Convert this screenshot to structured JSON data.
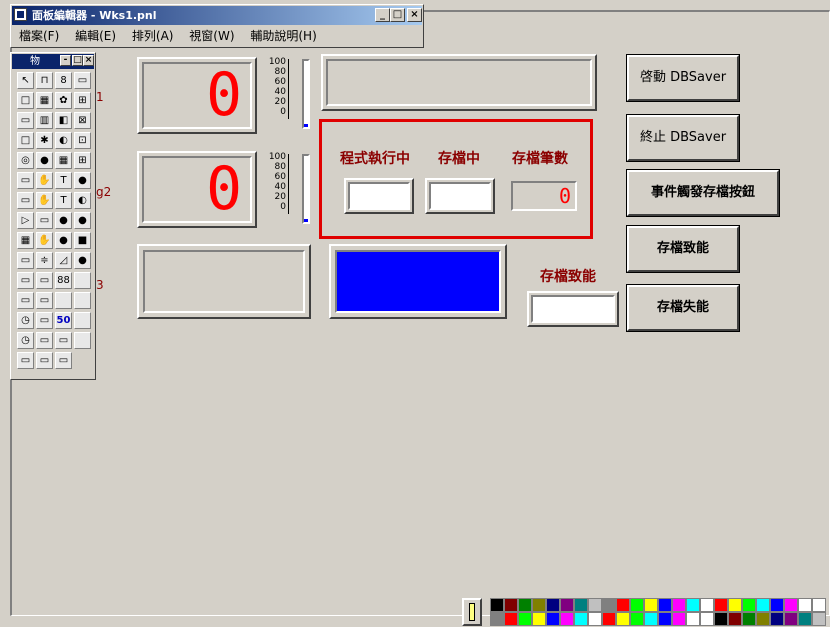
{
  "window": {
    "title": "面板編輯器 - Wks1.pnl",
    "menu": [
      "檔案(F)",
      "編輯(E)",
      "排列(A)",
      "視窗(W)",
      "輔助說明(H)"
    ],
    "controls": [
      "_",
      "□",
      "×"
    ]
  },
  "toolbox": {
    "title": "物",
    "controls": [
      "-",
      "□",
      "×"
    ],
    "fifty": "50"
  },
  "labels": {
    "g1": "1",
    "g2": "g2",
    "g3": "3"
  },
  "displays": {
    "top": "0",
    "middle": "0",
    "count": "0"
  },
  "scale_ticks": [
    "100",
    "80",
    "60",
    "40",
    "20",
    "0"
  ],
  "status": {
    "running": "程式執行中",
    "saving": "存檔中",
    "count_label": "存檔筆數",
    "enable_label": "存檔致能"
  },
  "buttons": {
    "start": "啓動 DBSaver",
    "stop": "終止 DBSaver",
    "event": "事件觸發存檔按鈕",
    "enable": "存檔致能",
    "disable": "存檔失能"
  },
  "colors": {
    "accent_blue": "#0000ff",
    "highlight_red": "#e00000",
    "label_red": "#8b0000",
    "palette": [
      "#000000",
      "#800000",
      "#008000",
      "#808000",
      "#000080",
      "#800080",
      "#008080",
      "#c0c0c0",
      "#808080",
      "#ff0000",
      "#00ff00",
      "#ffff00",
      "#0000ff",
      "#ff00ff",
      "#00ffff",
      "#ffffff",
      "#ff0000",
      "#ffff00",
      "#00ff00",
      "#00ffff",
      "#0000ff",
      "#ff00ff",
      "#ffffff",
      "#ffffff"
    ]
  }
}
